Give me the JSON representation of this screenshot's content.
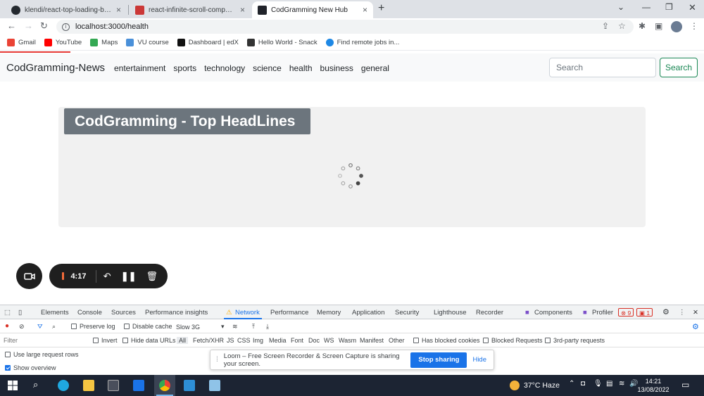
{
  "browser": {
    "tabs": [
      {
        "label": "klendi/react-top-loading-bar: A",
        "icon": "github-icon",
        "active": false
      },
      {
        "label": "react-infinite-scroll-component",
        "icon": "npm-icon",
        "active": false
      },
      {
        "label": "CodGramming New Hub",
        "icon": "react-icon",
        "active": true
      }
    ],
    "new_tab": "+",
    "address": "localhost:3000/health",
    "bookmarks": [
      {
        "label": "Gmail",
        "icon": "gmail-icon",
        "color": "#ea4335"
      },
      {
        "label": "YouTube",
        "icon": "youtube-icon",
        "color": "#ff0000"
      },
      {
        "label": "Maps",
        "icon": "maps-icon",
        "color": "#34a853"
      },
      {
        "label": "VU course",
        "icon": "vu-icon",
        "color": "#4a90d9"
      },
      {
        "label": "Dashboard | edX",
        "icon": "edx-icon",
        "color": "#111111"
      },
      {
        "label": "Hello World - Snack",
        "icon": "snack-icon",
        "color": "#333333"
      },
      {
        "label": "Find remote jobs in...",
        "icon": "jobs-icon",
        "color": "#1e88e5"
      }
    ],
    "loading_progress": 0.1
  },
  "page": {
    "brand": "CodGramming-News",
    "nav": [
      "entertainment",
      "sports",
      "technology",
      "science",
      "health",
      "business",
      "general"
    ],
    "search_placeholder": "Search",
    "search_button": "Search",
    "headline": "CodGramming - Top HeadLines"
  },
  "loom": {
    "timer": "4:17",
    "bar_message": "Loom – Free Screen Recorder & Screen Capture is sharing your screen.",
    "stop_sharing": "Stop sharing",
    "hide": "Hide"
  },
  "devtools": {
    "tabs": [
      "Elements",
      "Console",
      "Sources",
      "Performance insights",
      "Network",
      "Performance",
      "Memory",
      "Application",
      "Security",
      "Lighthouse",
      "Recorder",
      "Components",
      "Profiler"
    ],
    "active_tab": "Network",
    "errors": "9",
    "warnings": "1",
    "preserve_log": "Preserve log",
    "disable_cache": "Disable cache",
    "throttle": "Slow 3G",
    "filter_placeholder": "Filter",
    "invert": "Invert",
    "hide_data_urls": "Hide data URLs",
    "type_filters": [
      "All",
      "Fetch/XHR",
      "JS",
      "CSS",
      "Img",
      "Media",
      "Font",
      "Doc",
      "WS",
      "Wasm",
      "Manifest",
      "Other"
    ],
    "has_blocked_cookies": "Has blocked cookies",
    "blocked_requests": "Blocked Requests",
    "third_party": "3rd-party requests",
    "large_rows": "Use large request rows",
    "show_overview": "Show overview"
  },
  "taskbar": {
    "temperature": "37°C",
    "weather": "Haze",
    "time": "14:21",
    "date": "13/08/2022"
  }
}
